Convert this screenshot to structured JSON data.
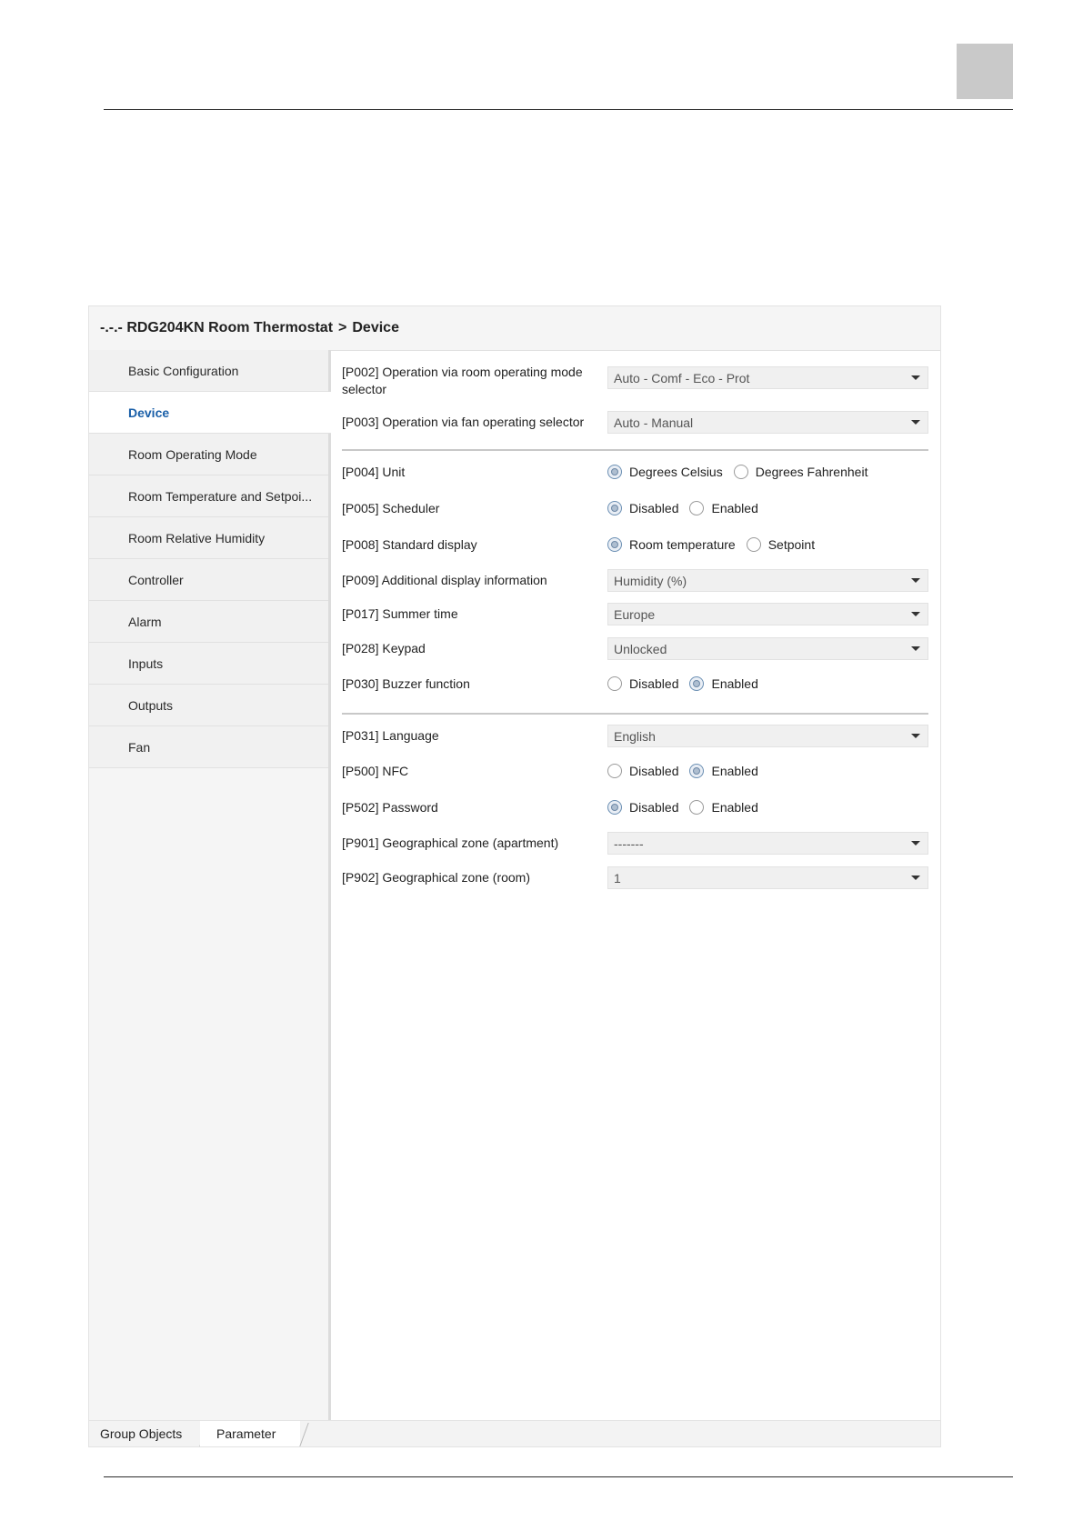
{
  "window": {
    "breadcrumb": [
      "-.-.- RDG204KN Room Thermostat",
      "Device"
    ],
    "breadcrumb_separator": ">"
  },
  "sidebar": {
    "items": [
      {
        "label": "Basic Configuration",
        "active": false
      },
      {
        "label": "Device",
        "active": true
      },
      {
        "label": "Room Operating Mode",
        "active": false
      },
      {
        "label": "Room Temperature and Setpoi...",
        "active": false
      },
      {
        "label": "Room Relative Humidity",
        "active": false
      },
      {
        "label": "Controller",
        "active": false
      },
      {
        "label": "Alarm",
        "active": false
      },
      {
        "label": "Inputs",
        "active": false
      },
      {
        "label": "Outputs",
        "active": false
      },
      {
        "label": "Fan",
        "active": false
      }
    ]
  },
  "params": {
    "p002": {
      "label": "[P002] Operation via room operating mode selector",
      "value": "Auto - Comf - Eco - Prot"
    },
    "p003": {
      "label": "[P003] Operation via fan operating selector",
      "value": "Auto - Manual"
    },
    "p004": {
      "label": "[P004] Unit",
      "options": [
        "Degrees Celsius",
        "Degrees Fahrenheit"
      ],
      "selected": 0
    },
    "p005": {
      "label": "[P005] Scheduler",
      "options": [
        "Disabled",
        "Enabled"
      ],
      "selected": 0
    },
    "p008": {
      "label": "[P008] Standard display",
      "options": [
        "Room temperature",
        "Setpoint"
      ],
      "selected": 0
    },
    "p009": {
      "label": "[P009] Additional display information",
      "value": "Humidity (%)"
    },
    "p017": {
      "label": "[P017] Summer time",
      "value": "Europe"
    },
    "p028": {
      "label": "[P028] Keypad",
      "value": "Unlocked"
    },
    "p030": {
      "label": "[P030] Buzzer function",
      "options": [
        "Disabled",
        "Enabled"
      ],
      "selected": 1
    },
    "p031": {
      "label": "[P031] Language",
      "value": "English"
    },
    "p500": {
      "label": "[P500] NFC",
      "options": [
        "Disabled",
        "Enabled"
      ],
      "selected": 1
    },
    "p502": {
      "label": "[P502] Password",
      "options": [
        "Disabled",
        "Enabled"
      ],
      "selected": 0
    },
    "p901": {
      "label": "[P901] Geographical zone (apartment)",
      "value": "-------"
    },
    "p902": {
      "label": "[P902] Geographical zone (room)",
      "value": "1"
    }
  },
  "tabs": {
    "group_objects": "Group Objects",
    "parameter": "Parameter",
    "active": "parameter"
  },
  "colors": {
    "active_nav_text": "#1a5fa8",
    "sidebar_bg": "#f5f5f5",
    "select_bg": "#f0f0f0"
  }
}
